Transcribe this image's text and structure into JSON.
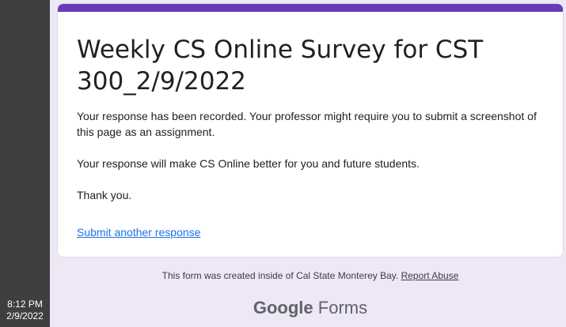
{
  "taskbar": {
    "time": "8:12 PM",
    "date": "2/9/2022"
  },
  "form": {
    "title": "Weekly CS Online Survey for CST 300_2/9/2022",
    "message_1": "Your response has been recorded. Your professor might require you to submit a screenshot of this page as an assignment.",
    "message_2": "Your response will make CS Online better for you and future students.",
    "message_3": "Thank you.",
    "submit_another_label": "Submit another response",
    "accent_color": "#673ab7"
  },
  "footer": {
    "created_text": "This form was created inside of Cal State Monterey Bay.",
    "report_abuse_label": "Report Abuse",
    "brand_google": "Google",
    "brand_forms": "Forms"
  }
}
